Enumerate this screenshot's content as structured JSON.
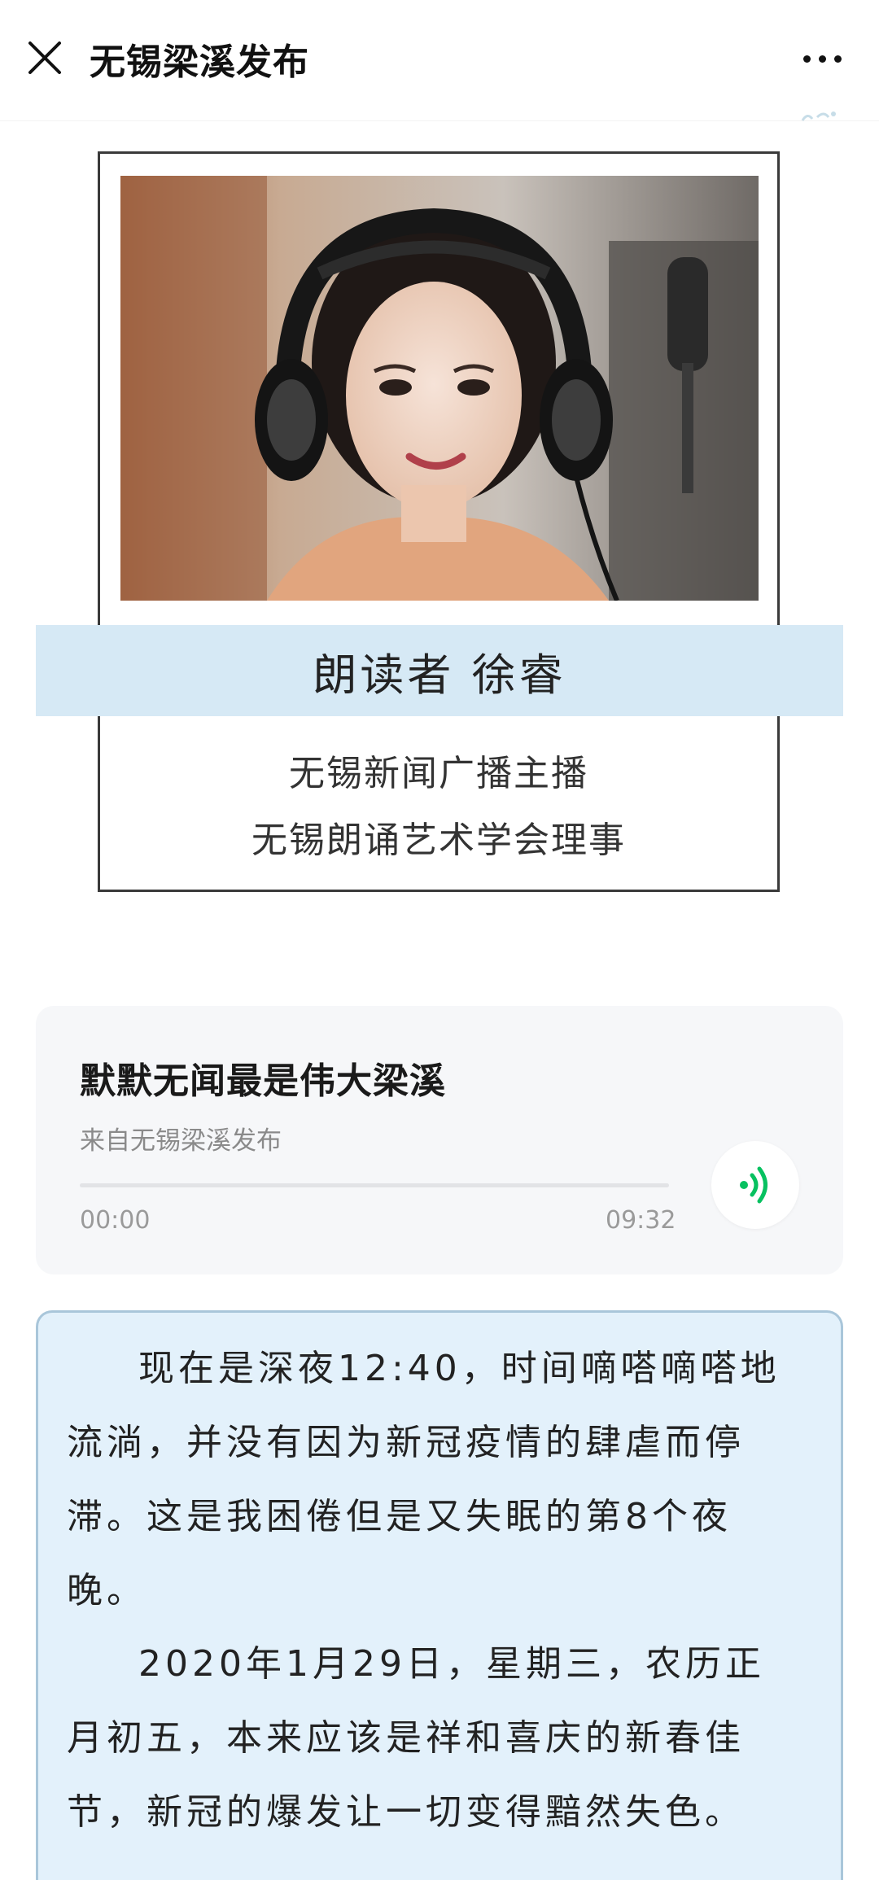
{
  "header": {
    "title": "无锡梁溪发布",
    "close_icon": "close-icon",
    "more_icon": "more-icon"
  },
  "profile": {
    "photo": "reader-portrait-photo",
    "banner": "朗读者 徐睿",
    "bio": [
      "无锡新闻广播主播",
      "无锡朗诵艺术学会理事"
    ]
  },
  "audio": {
    "title": "默默无闻最是伟大梁溪",
    "source": "来自无锡梁溪发布",
    "current_time": "00:00",
    "duration": "09:32",
    "progress": 0,
    "play_icon": "audio-wave-icon",
    "accent_color": "#07c160"
  },
  "article": {
    "paragraphs": [
      "现在是深夜12:40，时间嘀嗒嘀嗒地流淌，并没有因为新冠疫情的肆虐而停滞。这是我困倦但是又失眠的第8个夜晚。",
      "2020年1月29日，星期三，农历正月初五，本来应该是祥和喜庆的新春佳节，新冠的爆发让一切变得黯然失色。"
    ]
  },
  "colors": {
    "banner_bg": "#d6e9f5",
    "textbox_bg": "#e3f1fb",
    "textbox_border": "#a9c6da",
    "audio_card_bg": "#f6f7f9"
  }
}
